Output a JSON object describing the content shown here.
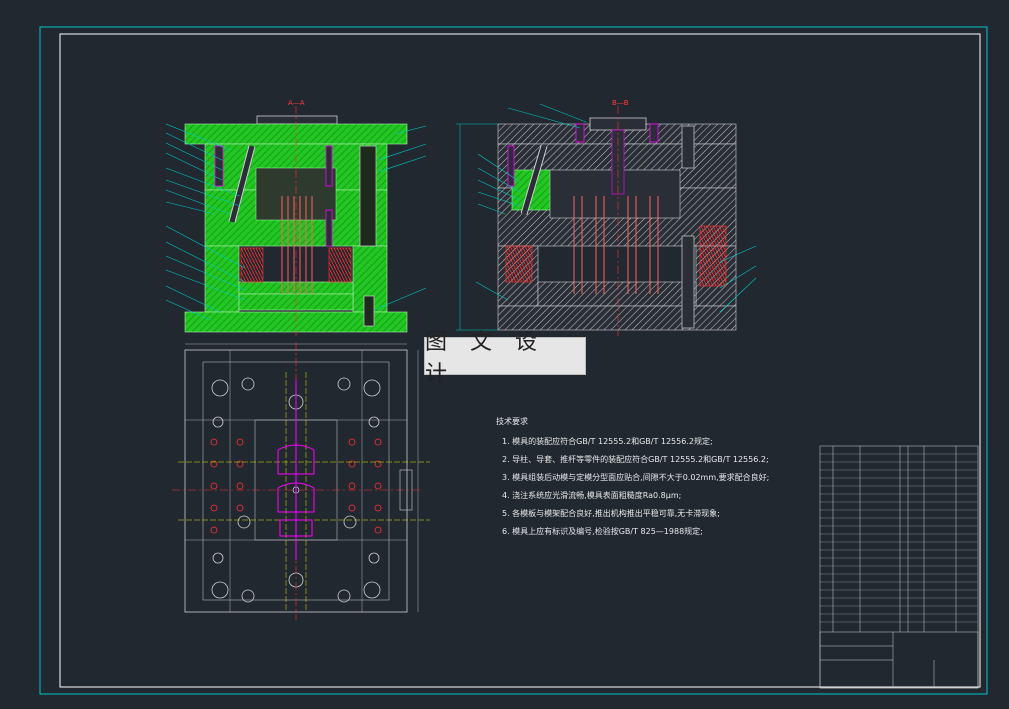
{
  "watermark": {
    "text": "图 文 设 计"
  },
  "views": {
    "section_aa_label": "A—A",
    "section_bb_label": "B—B"
  },
  "notes": {
    "title": "技术要求",
    "items": [
      "1. 模具的装配应符合GB/T 12555.2和GB/T 12556.2规定;",
      "2. 导柱、导套、推杆等零件的装配应符合GB/T 12555.2和GB/T 12556.2;",
      "3. 模具组装后动模与定模分型面应贴合,间隙不大于0.02mm,要求配合良好;",
      "4. 浇注系统应光滑流畅,模具表面粗糙度Ra0.8μm;",
      "5. 各模板与模架配合良好,推出机构推出平稳可靠,无卡滞现象;",
      "6. 模具上应有标识及编号,检验按GB/T 825—1988规定;"
    ]
  },
  "colors": {
    "background": "#212830",
    "frame_outer": "#00c8c8",
    "frame_inner": "#ffffff",
    "green_plate": "#22dd22",
    "hatch": "#c8c8c8",
    "centerline": "#ff3030",
    "spring": "#ff4040",
    "magenta": "#ff00ff",
    "yellow": "#e6e600"
  }
}
